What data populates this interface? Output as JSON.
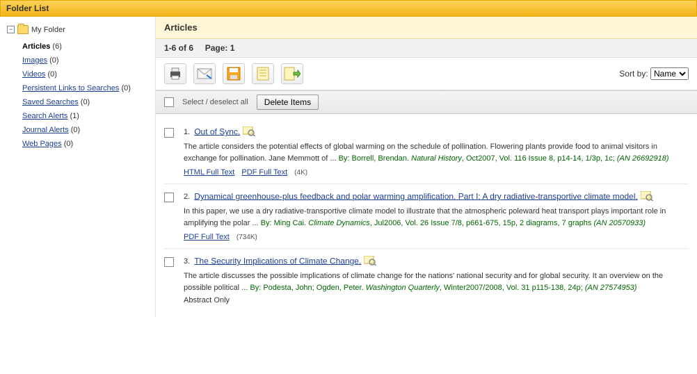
{
  "header": {
    "title": "Folder List"
  },
  "sidebar": {
    "root": "My Folder",
    "items": [
      {
        "label": "Articles",
        "count": "(6)",
        "active": true
      },
      {
        "label": "Images",
        "count": "(0)"
      },
      {
        "label": "Videos",
        "count": "(0)"
      },
      {
        "label": "Persistent Links to Searches",
        "count": "(0)"
      },
      {
        "label": "Saved Searches",
        "count": "(0)"
      },
      {
        "label": "Search Alerts",
        "count": "(1)"
      },
      {
        "label": "Journal Alerts",
        "count": "(0)"
      },
      {
        "label": "Web Pages",
        "count": "(0)"
      }
    ]
  },
  "content": {
    "heading": "Articles",
    "range": "1-6 of 6",
    "page_label": "Page: 1",
    "select_label": "Select / deselect all",
    "delete_label": "Delete Items",
    "sort_label": "Sort by:",
    "sort_value": "Name"
  },
  "icons": {
    "print": "print-icon",
    "email": "email-icon",
    "save": "save-icon",
    "notes": "notes-icon",
    "export": "export-icon"
  },
  "articles": [
    {
      "num": "1.",
      "title": "Out of Sync.",
      "abstract_pre": "The article considers the potential effects of global warming on the schedule of pollination. Flowering plants provide food to animal visitors in exchange for pollination. Jane Memmott of ... ",
      "by": "By: Borrell, Brendan. ",
      "journal": "Natural History",
      "cite": ", Oct2007, Vol. 116 Issue 8, p14-14, 1/3p, 1c; ",
      "an": "(AN 26692918)",
      "links": [
        {
          "label": "HTML Full Text",
          "size": ""
        },
        {
          "label": "PDF Full Text",
          "size": "(4K)"
        }
      ]
    },
    {
      "num": "2.",
      "title": "Dynamical greenhouse-plus feedback and polar warming amplification. Part I: A dry radiative-transportive climate model.",
      "abstract_pre": "In this paper, we use a dry radiative-transportive climate model to illustrate that the atmospheric poleward heat transport plays important role in amplifying the polar ... ",
      "by": "By: Ming Cai. ",
      "journal": "Climate Dynamics",
      "cite": ", Jul2006, Vol. 26 Issue 7/8, p661-675, 15p, 2 diagrams, 7 graphs ",
      "an": "(AN 20570933)",
      "links": [
        {
          "label": "PDF Full Text",
          "size": "(734K)"
        }
      ]
    },
    {
      "num": "3.",
      "title": "The Security Implications of Climate Change.",
      "abstract_pre": "The article discusses the possible implications of climate change for the nations' national security and for global security. It an overview on the possible political ... ",
      "by": "By: Podesta, John; Ogden, Peter. ",
      "journal": "Washington Quarterly",
      "cite": ", Winter2007/2008, Vol. 31 p115-138, 24p; ",
      "an": "(AN 27574953)",
      "abstract_only": "Abstract Only"
    }
  ]
}
